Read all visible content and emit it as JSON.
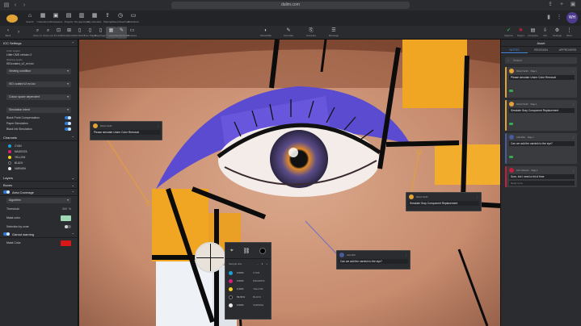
{
  "browser": {
    "url": "dalim.com"
  },
  "toolbar1": {
    "logo_text": "DALIM",
    "items": [
      {
        "icon": "⌂",
        "label": "Search"
      },
      {
        "icon": "▦",
        "label": "Collections"
      },
      {
        "icon": "▣",
        "label": "Workspaces"
      },
      {
        "icon": "▤",
        "label": "Projects"
      },
      {
        "icon": "▥",
        "label": "My approvals"
      },
      {
        "icon": "▦",
        "label": "My schedule"
      },
      {
        "icon": "⇪",
        "label": "Sharing"
      },
      {
        "icon": "◷",
        "label": "Saved Searches"
      },
      {
        "icon": "▭",
        "label": "Workflows"
      }
    ],
    "avatar": "WH"
  },
  "toolbar2": {
    "back_label": "Back",
    "items": [
      {
        "icon": "⌕",
        "label": "Zoom in"
      },
      {
        "icon": "⌕",
        "label": "Zoom out"
      },
      {
        "icon": "⊡",
        "label": "Fit width"
      },
      {
        "icon": "⊞",
        "label": "Actual size"
      },
      {
        "icon": "▯",
        "label": "Fit Fitwin"
      },
      {
        "icon": "▯",
        "label": "Prev Pages"
      },
      {
        "icon": "▯",
        "label": "Pag Pages"
      },
      {
        "icon": "▦",
        "label": "Loupe"
      },
      {
        "icon": "✎",
        "label": "Densitometer"
      },
      {
        "icon": "▭",
        "label": "Measure"
      }
    ],
    "center_items": [
      {
        "icon": "◐",
        "label": "Show/hide"
      },
      {
        "icon": "✎",
        "label": "Annotate"
      },
      {
        "icon": "⎘",
        "label": "Compare"
      },
      {
        "icon": "☰",
        "label": "Message"
      }
    ],
    "right_items": [
      {
        "icon": "✔",
        "label": "Approve",
        "color": "#38a84f"
      },
      {
        "icon": "✖",
        "label": "Reject",
        "color": "#c2203a"
      },
      {
        "icon": "▤",
        "label": "Compare"
      },
      {
        "icon": "⇩",
        "label": "Info"
      },
      {
        "icon": "⚙",
        "label": "Settings"
      },
      {
        "icon": "⋮",
        "label": "More"
      }
    ]
  },
  "left_panel": {
    "icc_title": "ICC Settings",
    "color_engine_label": "Color engine",
    "color_engine_value": "Little CMS version 2",
    "working_space_label": "Working space",
    "working_space_value": "ISOcoated_v2_eci.icc",
    "viewing_condition": "Viewing condition",
    "icc_profile": "ISO coated v2 eci.icc",
    "color_space": "Colour space dependent",
    "rendering_intent": "Simulation intent",
    "black_point": "Black Point Compensation",
    "paper_sim": "Paper Simulation",
    "black_ink_sim": "Black Ink Simulation",
    "channels_title": "Channels",
    "channels": [
      {
        "name": "CYAN",
        "color": "#1aa3d9"
      },
      {
        "name": "MAGENTA",
        "color": "#d81e7a"
      },
      {
        "name": "YELLOW",
        "color": "#f2d21b"
      },
      {
        "name": "BLACK",
        "color": "#111111"
      },
      {
        "name": "VARNISH",
        "color": "#e8e8e8"
      }
    ],
    "layers_title": "Layers",
    "boxes_title": "Boxes",
    "area_coverage": "Area Coverage",
    "algorithm": "Algorithm",
    "threshold_label": "Threshold",
    "threshold_value": "300",
    "threshold_unit": "%",
    "mask_color_label": "Mask color",
    "mask_color": "#9fd8b4",
    "selection_zone_label": "Selection by zone",
    "gamut_label": "Gamut warning",
    "mask_color2_label": "Mask Color",
    "mask_color2": "#d81818"
  },
  "right_panel": {
    "title": "Asset",
    "tabs": [
      "NOTES",
      "REVISION",
      "APPROVERS"
    ],
    "search_placeholder": "Search",
    "comments": [
      {
        "author": "Robert Smith",
        "page": "Page 1",
        "text": "Please simulate Under Color Removal",
        "type": "orange"
      },
      {
        "author": "Robert Smith",
        "page": "Page 1",
        "text": "Simulate Gray Component Replacement",
        "type": "orange"
      },
      {
        "author": "Julia Wild",
        "page": "Page 1",
        "text": "Can we add the varnish to the eye?",
        "type": "blue"
      },
      {
        "author": "John Johnson",
        "page": "Page 1",
        "text": "Sure, but I need a bit of time",
        "type": "red"
      }
    ],
    "reply_placeholder": "Reply here..."
  },
  "canvas_bubbles": [
    {
      "author": "Robert Smith",
      "page": "Page 1",
      "text": "Please simulate Under Color Removal"
    },
    {
      "author": "Robert Smith",
      "page": "Page 1",
      "text": "Simulate Gray Component Replacement"
    },
    {
      "author": "Julia Wild",
      "page": "Page 1",
      "text": "Can we add the varnish to the eye?"
    }
  ],
  "densitometer": {
    "sample_size_label": "Sample size",
    "sample_size": "1",
    "readings": [
      {
        "value": "0.00%",
        "name": "CYAN",
        "color": "#1aa3d9"
      },
      {
        "value": "0.00%",
        "name": "MAGENTA",
        "color": "#d81e7a"
      },
      {
        "value": "0.49%",
        "name": "YELLOW",
        "color": "#f2d21b"
      },
      {
        "value": "69.81%",
        "name": "BLACK",
        "color": "#111111"
      },
      {
        "value": "0.00%",
        "name": "VARNISH",
        "color": "#e8e8e8"
      }
    ]
  }
}
